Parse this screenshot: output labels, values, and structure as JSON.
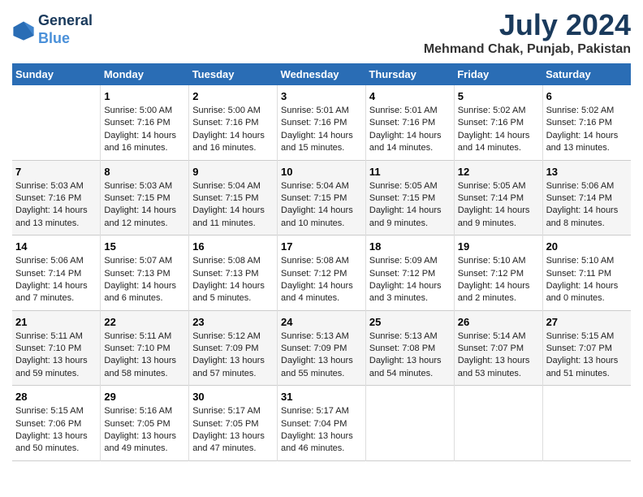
{
  "header": {
    "logo_line1": "General",
    "logo_line2": "Blue",
    "title": "July 2024",
    "subtitle": "Mehmand Chak, Punjab, Pakistan"
  },
  "days_of_week": [
    "Sunday",
    "Monday",
    "Tuesday",
    "Wednesday",
    "Thursday",
    "Friday",
    "Saturday"
  ],
  "weeks": [
    [
      {
        "day": "",
        "lines": []
      },
      {
        "day": "1",
        "lines": [
          "Sunrise: 5:00 AM",
          "Sunset: 7:16 PM",
          "Daylight: 14 hours",
          "and 16 minutes."
        ]
      },
      {
        "day": "2",
        "lines": [
          "Sunrise: 5:00 AM",
          "Sunset: 7:16 PM",
          "Daylight: 14 hours",
          "and 16 minutes."
        ]
      },
      {
        "day": "3",
        "lines": [
          "Sunrise: 5:01 AM",
          "Sunset: 7:16 PM",
          "Daylight: 14 hours",
          "and 15 minutes."
        ]
      },
      {
        "day": "4",
        "lines": [
          "Sunrise: 5:01 AM",
          "Sunset: 7:16 PM",
          "Daylight: 14 hours",
          "and 14 minutes."
        ]
      },
      {
        "day": "5",
        "lines": [
          "Sunrise: 5:02 AM",
          "Sunset: 7:16 PM",
          "Daylight: 14 hours",
          "and 14 minutes."
        ]
      },
      {
        "day": "6",
        "lines": [
          "Sunrise: 5:02 AM",
          "Sunset: 7:16 PM",
          "Daylight: 14 hours",
          "and 13 minutes."
        ]
      }
    ],
    [
      {
        "day": "7",
        "lines": [
          "Sunrise: 5:03 AM",
          "Sunset: 7:16 PM",
          "Daylight: 14 hours",
          "and 13 minutes."
        ]
      },
      {
        "day": "8",
        "lines": [
          "Sunrise: 5:03 AM",
          "Sunset: 7:15 PM",
          "Daylight: 14 hours",
          "and 12 minutes."
        ]
      },
      {
        "day": "9",
        "lines": [
          "Sunrise: 5:04 AM",
          "Sunset: 7:15 PM",
          "Daylight: 14 hours",
          "and 11 minutes."
        ]
      },
      {
        "day": "10",
        "lines": [
          "Sunrise: 5:04 AM",
          "Sunset: 7:15 PM",
          "Daylight: 14 hours",
          "and 10 minutes."
        ]
      },
      {
        "day": "11",
        "lines": [
          "Sunrise: 5:05 AM",
          "Sunset: 7:15 PM",
          "Daylight: 14 hours",
          "and 9 minutes."
        ]
      },
      {
        "day": "12",
        "lines": [
          "Sunrise: 5:05 AM",
          "Sunset: 7:14 PM",
          "Daylight: 14 hours",
          "and 9 minutes."
        ]
      },
      {
        "day": "13",
        "lines": [
          "Sunrise: 5:06 AM",
          "Sunset: 7:14 PM",
          "Daylight: 14 hours",
          "and 8 minutes."
        ]
      }
    ],
    [
      {
        "day": "14",
        "lines": [
          "Sunrise: 5:06 AM",
          "Sunset: 7:14 PM",
          "Daylight: 14 hours",
          "and 7 minutes."
        ]
      },
      {
        "day": "15",
        "lines": [
          "Sunrise: 5:07 AM",
          "Sunset: 7:13 PM",
          "Daylight: 14 hours",
          "and 6 minutes."
        ]
      },
      {
        "day": "16",
        "lines": [
          "Sunrise: 5:08 AM",
          "Sunset: 7:13 PM",
          "Daylight: 14 hours",
          "and 5 minutes."
        ]
      },
      {
        "day": "17",
        "lines": [
          "Sunrise: 5:08 AM",
          "Sunset: 7:12 PM",
          "Daylight: 14 hours",
          "and 4 minutes."
        ]
      },
      {
        "day": "18",
        "lines": [
          "Sunrise: 5:09 AM",
          "Sunset: 7:12 PM",
          "Daylight: 14 hours",
          "and 3 minutes."
        ]
      },
      {
        "day": "19",
        "lines": [
          "Sunrise: 5:10 AM",
          "Sunset: 7:12 PM",
          "Daylight: 14 hours",
          "and 2 minutes."
        ]
      },
      {
        "day": "20",
        "lines": [
          "Sunrise: 5:10 AM",
          "Sunset: 7:11 PM",
          "Daylight: 14 hours",
          "and 0 minutes."
        ]
      }
    ],
    [
      {
        "day": "21",
        "lines": [
          "Sunrise: 5:11 AM",
          "Sunset: 7:10 PM",
          "Daylight: 13 hours",
          "and 59 minutes."
        ]
      },
      {
        "day": "22",
        "lines": [
          "Sunrise: 5:11 AM",
          "Sunset: 7:10 PM",
          "Daylight: 13 hours",
          "and 58 minutes."
        ]
      },
      {
        "day": "23",
        "lines": [
          "Sunrise: 5:12 AM",
          "Sunset: 7:09 PM",
          "Daylight: 13 hours",
          "and 57 minutes."
        ]
      },
      {
        "day": "24",
        "lines": [
          "Sunrise: 5:13 AM",
          "Sunset: 7:09 PM",
          "Daylight: 13 hours",
          "and 55 minutes."
        ]
      },
      {
        "day": "25",
        "lines": [
          "Sunrise: 5:13 AM",
          "Sunset: 7:08 PM",
          "Daylight: 13 hours",
          "and 54 minutes."
        ]
      },
      {
        "day": "26",
        "lines": [
          "Sunrise: 5:14 AM",
          "Sunset: 7:07 PM",
          "Daylight: 13 hours",
          "and 53 minutes."
        ]
      },
      {
        "day": "27",
        "lines": [
          "Sunrise: 5:15 AM",
          "Sunset: 7:07 PM",
          "Daylight: 13 hours",
          "and 51 minutes."
        ]
      }
    ],
    [
      {
        "day": "28",
        "lines": [
          "Sunrise: 5:15 AM",
          "Sunset: 7:06 PM",
          "Daylight: 13 hours",
          "and 50 minutes."
        ]
      },
      {
        "day": "29",
        "lines": [
          "Sunrise: 5:16 AM",
          "Sunset: 7:05 PM",
          "Daylight: 13 hours",
          "and 49 minutes."
        ]
      },
      {
        "day": "30",
        "lines": [
          "Sunrise: 5:17 AM",
          "Sunset: 7:05 PM",
          "Daylight: 13 hours",
          "and 47 minutes."
        ]
      },
      {
        "day": "31",
        "lines": [
          "Sunrise: 5:17 AM",
          "Sunset: 7:04 PM",
          "Daylight: 13 hours",
          "and 46 minutes."
        ]
      },
      {
        "day": "",
        "lines": []
      },
      {
        "day": "",
        "lines": []
      },
      {
        "day": "",
        "lines": []
      }
    ]
  ]
}
